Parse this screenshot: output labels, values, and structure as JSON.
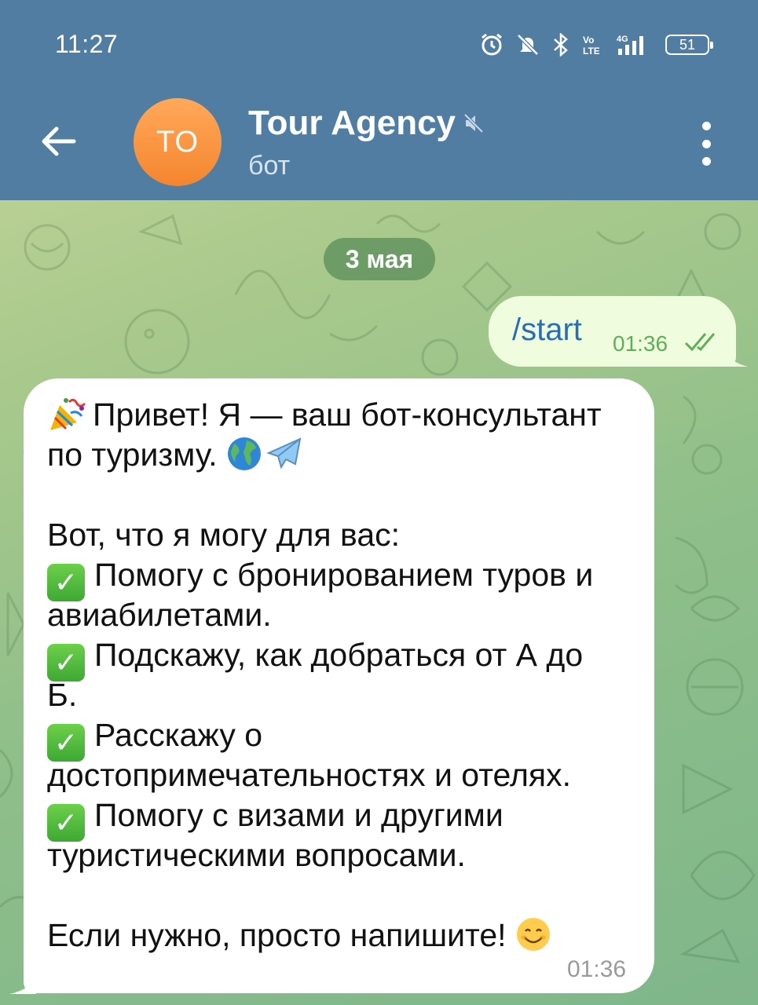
{
  "status_bar": {
    "time": "11:27",
    "battery": "51",
    "icons": [
      "alarm-icon",
      "bell-muted-icon",
      "bluetooth-icon",
      "volte-icon",
      "signal-4g-icon",
      "battery-icon"
    ]
  },
  "header": {
    "back_icon": "arrow-left-icon",
    "avatar_initials": "TO",
    "title": "Tour Agency",
    "title_icon": "muted-speaker-icon",
    "subtitle": "бот",
    "more_icon": "more-vertical-icon",
    "color": "#517da2"
  },
  "chat": {
    "date": "3 мая",
    "outgoing": {
      "text": "/start",
      "time": "01:36",
      "status_icon": "double-check-icon"
    },
    "incoming": {
      "lines": [
        {
          "emoji": "party-popper-icon",
          "text": "Привет! Я — ваш бот-консультант"
        },
        {
          "text": "по туризму. ",
          "emoji_after": [
            "globe-icon",
            "airplane-icon"
          ]
        },
        {
          "blank": true
        },
        {
          "text": "Вот, что я могу для вас:"
        },
        {
          "check": true,
          "text": "Помогу с бронированием туров и"
        },
        {
          "text": "авиабилетами."
        },
        {
          "check": true,
          "text": "Подскажу, как добраться от А до"
        },
        {
          "text": "Б."
        },
        {
          "check": true,
          "text": "Расскажу о"
        },
        {
          "text": "достопримечательностях и отелях."
        },
        {
          "check": true,
          "text": "Помогу с визами и другими"
        },
        {
          "text": "туристическими вопросами."
        },
        {
          "blank": true
        },
        {
          "text": "Если нужно, просто напишите! ",
          "emoji_after": [
            "smiling-face-icon"
          ]
        }
      ],
      "time": "01:36"
    }
  }
}
